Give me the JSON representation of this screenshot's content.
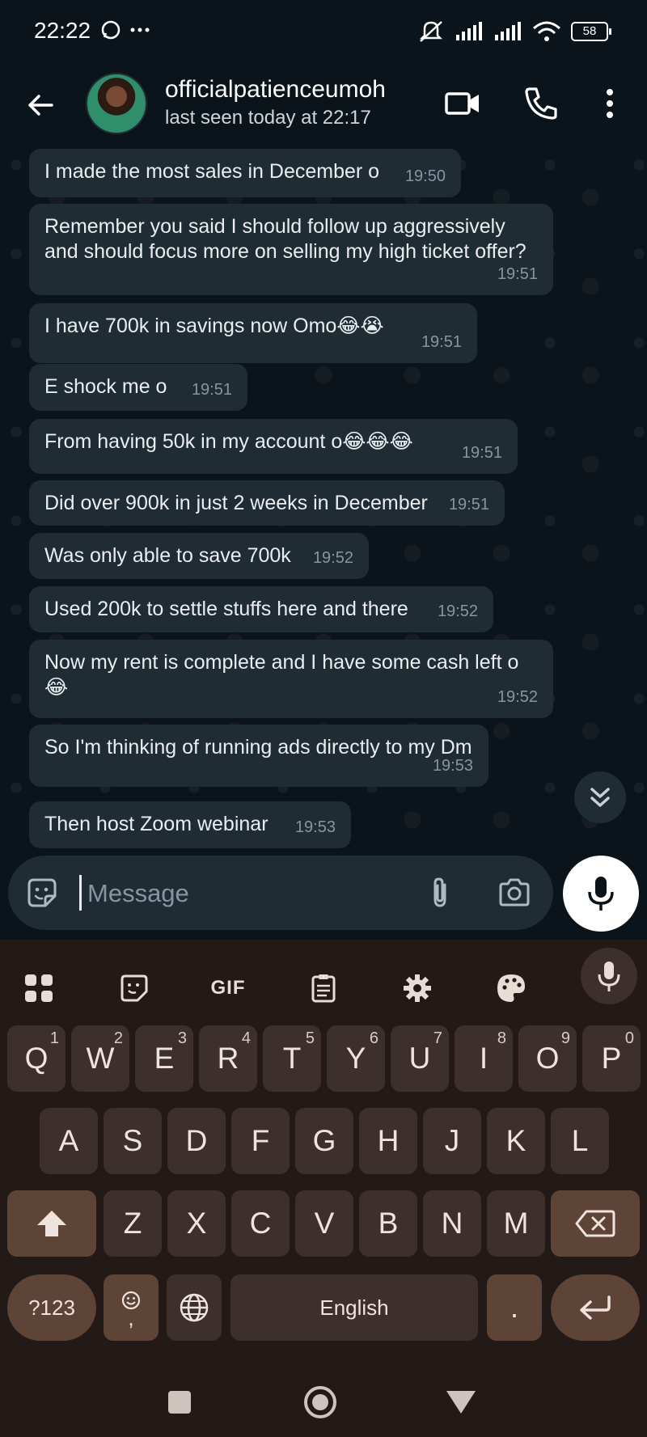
{
  "status_bar": {
    "time": "22:22",
    "battery": "58",
    "icons": [
      "whatsapp-status-icon",
      "more-dots-icon",
      "mute-icon",
      "signal-icon",
      "signal-icon",
      "wifi-icon",
      "battery-icon"
    ]
  },
  "header": {
    "contact_name": "officialpatienceumoh",
    "contact_status": "last seen today at 22:17",
    "icons": [
      "back-arrow-icon",
      "video-call-icon",
      "voice-call-icon",
      "overflow-menu-icon"
    ]
  },
  "messages": [
    {
      "text": "I made the most sales in December o",
      "time": "19:50"
    },
    {
      "text": "Remember you said I should follow up aggressively\nand should focus more on selling my high ticket offer?",
      "time": "19:51"
    },
    {
      "text": "I have 700k in savings now Omo😂😭",
      "time": "19:51"
    },
    {
      "text": "E shock me o",
      "time": "19:51"
    },
    {
      "text": "From having 50k in my account o😂😂😂",
      "time": "19:51"
    },
    {
      "text": "Did over 900k in just 2 weeks in December",
      "time": "19:51"
    },
    {
      "text": "Was only able to save 700k",
      "time": "19:52"
    },
    {
      "text": "Used 200k to settle stuffs here and there",
      "time": "19:52"
    },
    {
      "text": "Now my rent is complete and I have some cash left o\n😂",
      "time": "19:52"
    },
    {
      "text": "So I'm thinking of running ads directly to my Dm",
      "time": "19:53"
    },
    {
      "text": "Then host Zoom webinar",
      "time": "19:53"
    }
  ],
  "composer": {
    "placeholder": "Message",
    "value": ""
  },
  "keyboard": {
    "toolbar": {
      "gif_label": "GIF"
    },
    "row1": [
      {
        "k": "Q",
        "h": "1"
      },
      {
        "k": "W",
        "h": "2"
      },
      {
        "k": "E",
        "h": "3"
      },
      {
        "k": "R",
        "h": "4"
      },
      {
        "k": "T",
        "h": "5"
      },
      {
        "k": "Y",
        "h": "6"
      },
      {
        "k": "U",
        "h": "7"
      },
      {
        "k": "I",
        "h": "8"
      },
      {
        "k": "O",
        "h": "9"
      },
      {
        "k": "P",
        "h": "0"
      }
    ],
    "row2": [
      "A",
      "S",
      "D",
      "F",
      "G",
      "H",
      "J",
      "K",
      "L"
    ],
    "row3": [
      "Z",
      "X",
      "C",
      "V",
      "B",
      "N",
      "M"
    ],
    "row4": {
      "symbols": "?123",
      "comma": ",",
      "space": "English",
      "period": "."
    }
  },
  "colors": {
    "background": "#0b141a",
    "bubble": "#202c33",
    "timestamp": "#8696a0",
    "keyboard": "#231a17",
    "key": "#3d302c",
    "modifier_key": "#5e4337"
  }
}
